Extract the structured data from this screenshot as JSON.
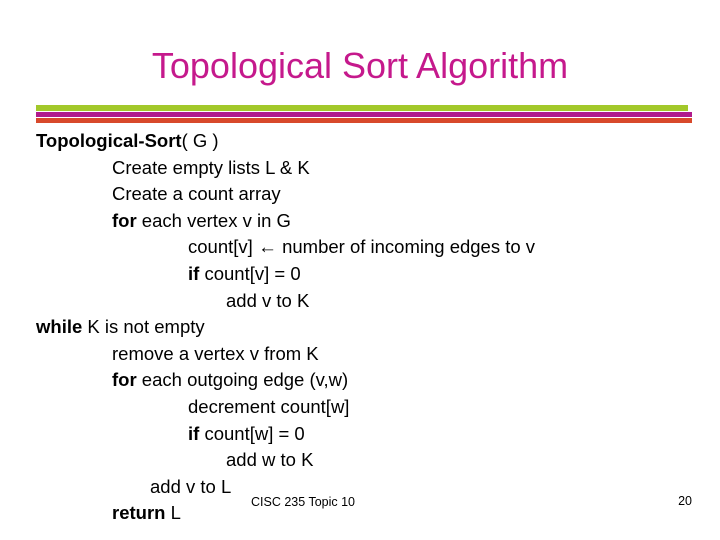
{
  "slide": {
    "title": "Topological Sort Algorithm",
    "title_color": "#C5198C",
    "background": "#ffffff"
  },
  "dividers": [
    {
      "name": "green-rule",
      "color": "#A2C82A"
    },
    {
      "name": "purple-rule",
      "color": "#B01B8C"
    },
    {
      "name": "orange-rule",
      "color": "#D8492B"
    }
  ],
  "pseudocode": {
    "lines": [
      {
        "indent": 0,
        "bold_prefix": "Topological-Sort",
        "rest": "( G )"
      },
      {
        "indent": 1,
        "bold_prefix": "",
        "rest": "Create empty lists L & K"
      },
      {
        "indent": 1,
        "bold_prefix": "",
        "rest": "Create a count array"
      },
      {
        "indent": 1,
        "bold_prefix": "for",
        "rest": " each vertex v in G"
      },
      {
        "indent": 2,
        "bold_prefix": "",
        "rest": "count[v] ← number of incoming edges to v"
      },
      {
        "indent": 2,
        "bold_prefix": "if",
        "rest": " count[v] = 0"
      },
      {
        "indent": 3,
        "bold_prefix": "",
        "rest": "add v to K"
      },
      {
        "indent": 0,
        "bold_prefix": "while",
        "rest": " K is not empty"
      },
      {
        "indent": 1,
        "bold_prefix": "",
        "rest": "remove a vertex v from K"
      },
      {
        "indent": 1,
        "bold_prefix": "for",
        "rest": " each outgoing edge (v,w)"
      },
      {
        "indent": 2,
        "bold_prefix": "",
        "rest": "decrement count[w]"
      },
      {
        "indent": 2,
        "bold_prefix": "if",
        "rest": " count[w] = 0"
      },
      {
        "indent": 3,
        "bold_prefix": "",
        "rest": "add w to K"
      },
      {
        "indent": 5,
        "bold_prefix": "",
        "rest": "add v to L"
      },
      {
        "indent": 6,
        "bold_prefix": "return",
        "rest": " L"
      }
    ],
    "l0_text": "Topological-Sort",
    "l0_rest": "( G )",
    "l1_text": "Create empty lists L & K",
    "l2_text": "Create a count array",
    "l3_kw": "for",
    "l3_text": " each vertex v in G",
    "l4_a": "count[v] ",
    "l4_arrow": "←",
    "l4_b": " number of incoming edges to v",
    "l5_kw": "if",
    "l5_text": " count[v] = 0",
    "l6_text": "add v to K",
    "l7_kw": "while",
    "l7_text": " K is not empty",
    "l8_text": "remove a vertex v from K",
    "l9_kw": "for",
    "l9_text": " each outgoing edge (v,w)",
    "l10_text": "decrement count[w]",
    "l11_kw": "if",
    "l11_text": " count[w] = 0",
    "l12_text": "add w to K",
    "l13_text": "add v to L",
    "l14_kw": "return",
    "l14_text": " L"
  },
  "footer": {
    "center_text": "CISC 235 Topic 10",
    "page_number": "20"
  }
}
